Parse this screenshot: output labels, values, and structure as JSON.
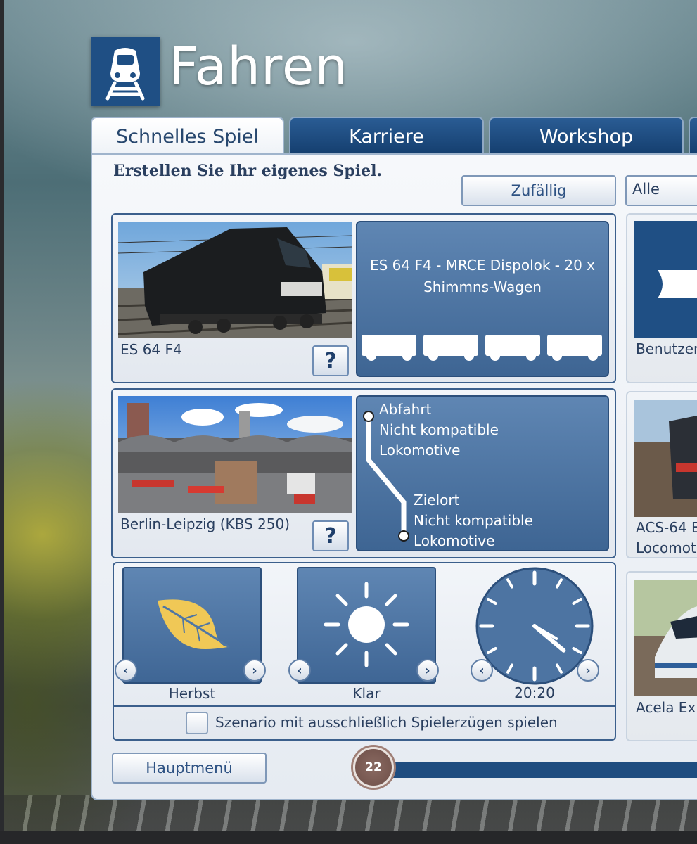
{
  "header": {
    "title": "Fahren",
    "icon": "train-icon"
  },
  "tabs": [
    {
      "label": "Schnelles Spiel",
      "active": true
    },
    {
      "label": "Karriere",
      "active": false
    },
    {
      "label": "Workshop",
      "active": false
    }
  ],
  "main": {
    "subtitle": "Erstellen Sie Ihr eigenes Spiel.",
    "random_button": "Zufällig",
    "filter_dropdown": "Alle"
  },
  "locomotive": {
    "name": "ES 64 F4",
    "consist": "ES 64 F4 - MRCE Dispolok - 20 x Shimmns-Wagen",
    "help_label": "?"
  },
  "route": {
    "name": "Berlin-Leipzig (KBS 250)",
    "help_label": "?",
    "departure_title": "Abfahrt",
    "departure_status": "Nicht kompatible Lokomotive",
    "destination_title": "Zielort",
    "destination_status": "Nicht kompatible Lokomotive"
  },
  "conditions": {
    "season": "Herbst",
    "weather": "Klar",
    "time": "20:20",
    "clock_hour_angle_deg": 130,
    "clock_minute_angle_deg": 120,
    "player_only_label": "Szenario mit ausschließlich Spielerzügen spielen",
    "player_only_checked": false
  },
  "side_list": [
    {
      "label": "Benutzer"
    },
    {
      "label_line1": "ACS-64 E",
      "label_line2": "Locomot"
    },
    {
      "label": "Acela Exp"
    }
  ],
  "footer": {
    "main_menu_button": "Hauptmenü",
    "badge": "22"
  },
  "colors": {
    "accent_dark_blue": "#1f4f84",
    "tile_blue": "#4f76a4",
    "text_blue": "#2a3f5f",
    "leaf_yellow": "#f0c856"
  }
}
